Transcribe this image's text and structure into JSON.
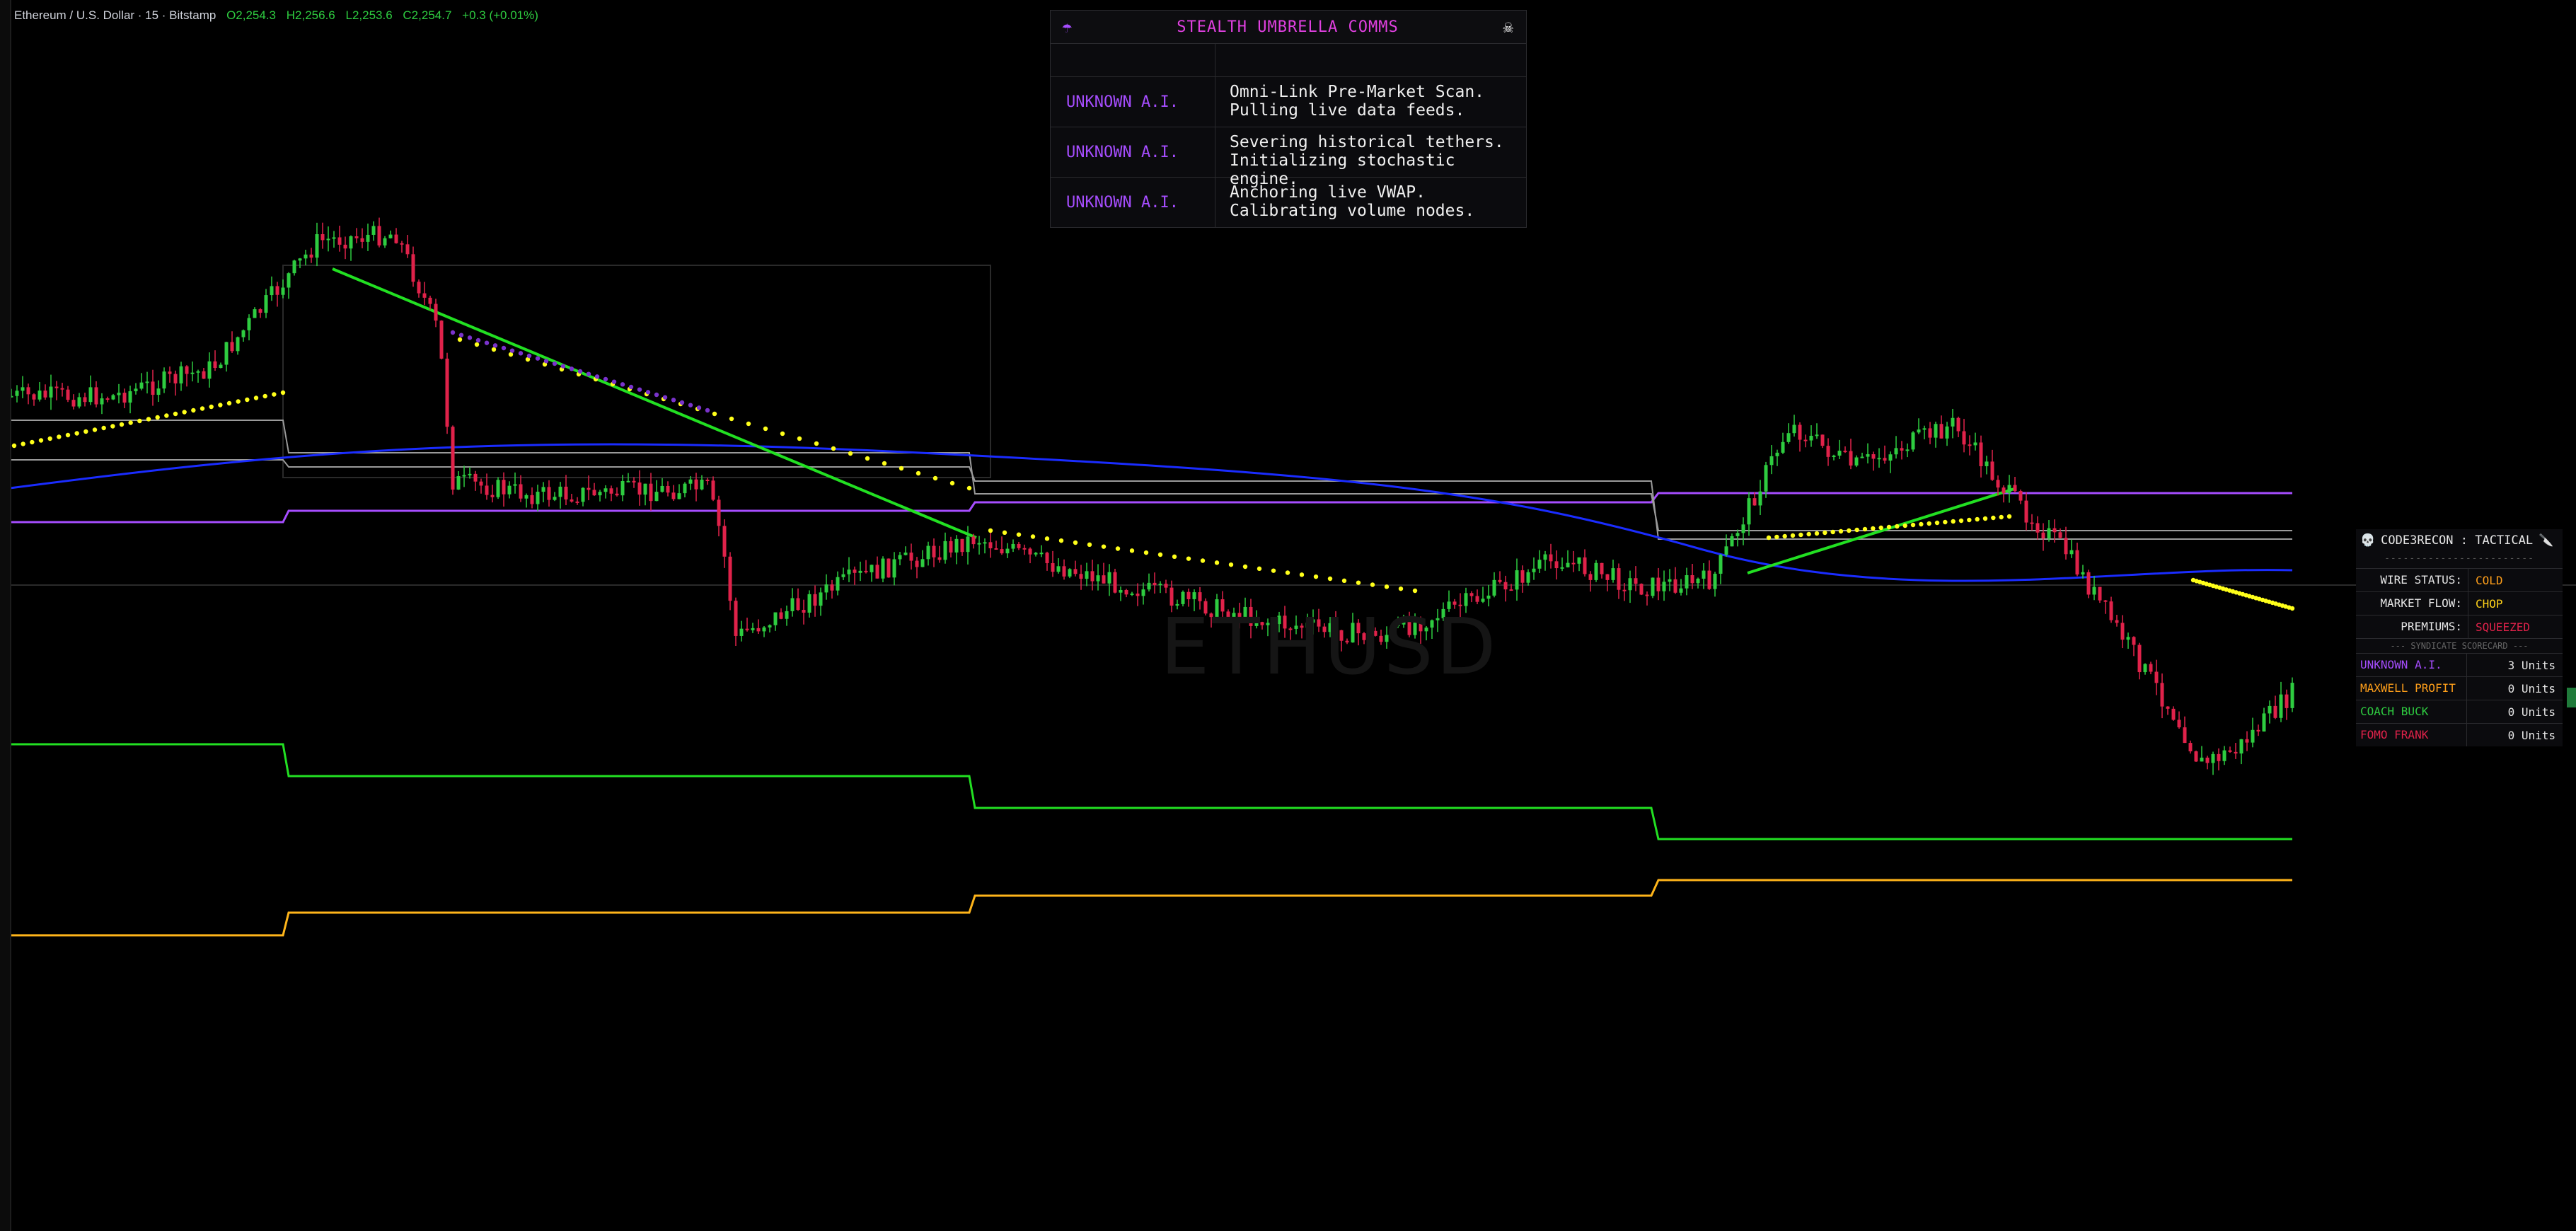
{
  "legend": {
    "symbol": "Ethereum / U.S. Dollar · 15 · Bitstamp",
    "open": "O2,254.3",
    "high": "H2,256.6",
    "low": "L2,253.6",
    "close": "C2,254.7",
    "change": "+0.3 (+0.01%)"
  },
  "watermark": "ETHUSD",
  "comms": {
    "icon_left": "umbrella-icon",
    "title": "STEALTH UMBRELLA COMMS",
    "icon_right": "skull-crossbones-icon",
    "glyph_left": "☂",
    "glyph_right": "☠",
    "rows": [
      {
        "sender": "UNKNOWN A.I.",
        "line1": "Omni-Link Pre-Market Scan.",
        "line2": "Pulling live data feeds."
      },
      {
        "sender": "UNKNOWN A.I.",
        "line1": "Severing historical tethers.",
        "line2": "Initializing stochastic engine."
      },
      {
        "sender": "UNKNOWN A.I.",
        "line1": "Anchoring live VWAP.",
        "line2": "Calibrating volume nodes."
      }
    ]
  },
  "recon": {
    "glyph_skull": "💀",
    "title": "CODE3RECON : TACTICAL",
    "glyph_knife": "🔪",
    "dashes": "------------------------",
    "wire_label": "WIRE STATUS:",
    "wire_value": "COLD",
    "flow_label": "MARKET FLOW:",
    "flow_value": "CHOP",
    "prem_label": "PREMIUMS:",
    "prem_value": "SQUEEZED",
    "scorecard_title": "--- SYNDICATE SCORECARD ---",
    "scorecard": [
      {
        "name": "UNKNOWN A.I.",
        "units": "3 Units",
        "color": "#a64dff"
      },
      {
        "name": "MAXWELL PROFIT",
        "units": "0 Units",
        "color": "#ff9f1a"
      },
      {
        "name": "COACH BUCK",
        "units": "0 Units",
        "color": "#2ecc40"
      },
      {
        "name": "FOMO FRANK",
        "units": "0 Units",
        "color": "#e0224a"
      }
    ]
  },
  "colors": {
    "up": "#2ecc40",
    "down": "#e0224a",
    "background": "#000000",
    "wire": "#ff9f1a",
    "flow": "#ffd21a",
    "premiums": "#e0224a"
  }
}
